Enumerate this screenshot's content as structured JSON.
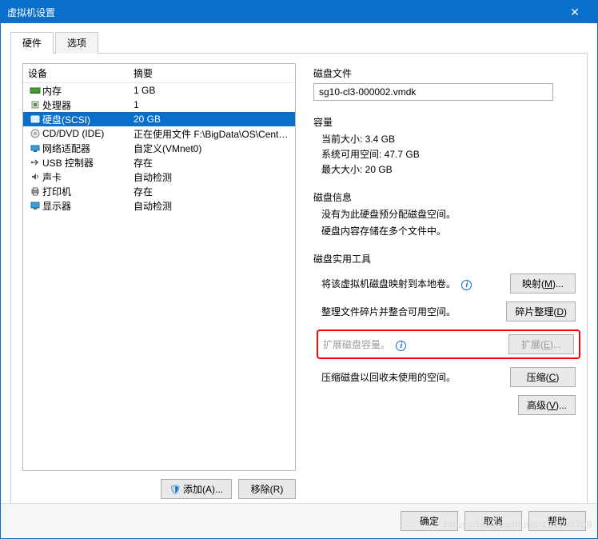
{
  "window": {
    "title": "虚拟机设置"
  },
  "tabs": {
    "hardware": "硬件",
    "options": "选项"
  },
  "dev_header": {
    "device": "设备",
    "summary": "摘要"
  },
  "devices": [
    {
      "name": "内存",
      "summary": "1 GB",
      "icon": "memory"
    },
    {
      "name": "处理器",
      "summary": "1",
      "icon": "cpu"
    },
    {
      "name": "硬盘(SCSI)",
      "summary": "20 GB",
      "icon": "disk",
      "selected": true
    },
    {
      "name": "CD/DVD (IDE)",
      "summary": "正在使用文件 F:\\BigData\\OS\\CentO...",
      "icon": "cd"
    },
    {
      "name": "网络适配器",
      "summary": "自定义(VMnet0)",
      "icon": "net"
    },
    {
      "name": "USB 控制器",
      "summary": "存在",
      "icon": "usb"
    },
    {
      "name": "声卡",
      "summary": "自动检测",
      "icon": "sound"
    },
    {
      "name": "打印机",
      "summary": "存在",
      "icon": "printer"
    },
    {
      "name": "显示器",
      "summary": "自动检测",
      "icon": "display"
    }
  ],
  "left_buttons": {
    "add": "添加(A)...",
    "remove": "移除(R)"
  },
  "right": {
    "disk_file_label": "磁盘文件",
    "disk_file": "sg10-cl3-000002.vmdk",
    "capacity_label": "容量",
    "current_size": "当前大小: 3.4 GB",
    "free_space": "系统可用空间: 47.7 GB",
    "max_size": "最大大小: 20 GB",
    "disk_info_label": "磁盘信息",
    "disk_info_1": "没有为此硬盘预分配磁盘空间。",
    "disk_info_2": "硬盘内容存储在多个文件中。",
    "util_label": "磁盘实用工具",
    "map_desc": "将该虚拟机磁盘映射到本地卷。",
    "map_btn": "映射(M)...",
    "defrag_desc": "整理文件碎片并整合可用空间。",
    "defrag_btn": "碎片整理(D)",
    "expand_desc": "扩展磁盘容量。",
    "expand_btn": "扩展(E)...",
    "compact_desc": "压缩磁盘以回收未使用的空间。",
    "compact_btn": "压缩(C)",
    "advanced_btn": "高级(V)..."
  },
  "footer": {
    "ok": "确定",
    "cancel": "取消",
    "help": "帮助"
  },
  "watermark": "https://blog.csdn.net/121138708"
}
